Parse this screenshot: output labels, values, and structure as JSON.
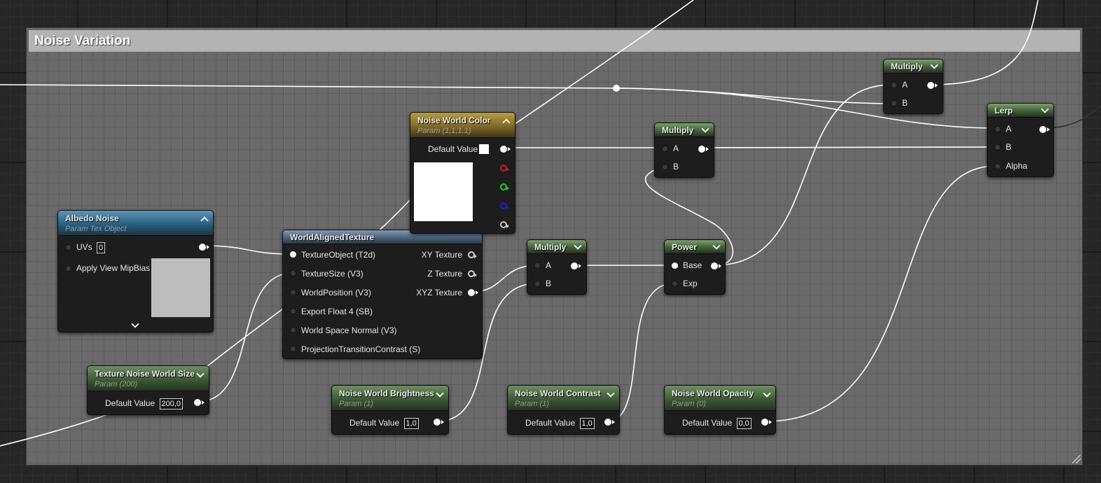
{
  "comment": {
    "title": "Noise Variation"
  },
  "nodes": {
    "albedo_noise": {
      "title": "Albedo Noise",
      "subtitle": "Param Tex Object",
      "uvs_label": "UVs",
      "uvs_value": "0",
      "mipbias_label": "Apply View MipBias"
    },
    "world_aligned_texture": {
      "title": "WorldAlignedTexture",
      "inputs": [
        "TextureObject (T2d)",
        "TextureSize (V3)",
        "WorldPosition (V3)",
        "Export Float 4 (SB)",
        "World Space Normal (V3)",
        "ProjectionTransitionContrast (S)"
      ],
      "outputs": [
        "XY Texture",
        "Z Texture",
        "XYZ Texture"
      ]
    },
    "noise_world_color": {
      "title": "Noise World Color",
      "subtitle": "Param (1,1,1,1)",
      "default_label": "Default Value"
    },
    "texture_noise_world_size": {
      "title": "Texture Noise World Size",
      "subtitle": "Param (200)",
      "default_label": "Default Value",
      "default_value": "200,0"
    },
    "noise_world_brightness": {
      "title": "Noise World Brightness",
      "subtitle": "Param (1)",
      "default_label": "Default Value",
      "default_value": "1,0"
    },
    "noise_world_contrast": {
      "title": "Noise World Contrast",
      "subtitle": "Param (1)",
      "default_label": "Default Value",
      "default_value": "1,0"
    },
    "noise_world_opacity": {
      "title": "Noise World Opacity",
      "subtitle": "Param (0)",
      "default_label": "Default Value",
      "default_value": "0,0"
    },
    "multiply_1": {
      "title": "Multiply",
      "a": "A",
      "b": "B"
    },
    "multiply_2": {
      "title": "Multiply",
      "a": "A",
      "b": "B"
    },
    "multiply_3": {
      "title": "Multiply",
      "a": "A",
      "b": "B"
    },
    "power": {
      "title": "Power",
      "base": "Base",
      "exp": "Exp"
    },
    "lerp": {
      "title": "Lerp",
      "a": "A",
      "b": "B",
      "alpha": "Alpha"
    }
  },
  "colors": {
    "canvas_bg": "#262626",
    "comment_bg": "#6a6a6a",
    "comment_title_bg": "#b3b3b3",
    "node_body": "#1c1d1c",
    "wire": "#ffffff",
    "param_header": "#4a6b40",
    "texture_param_header": "#28607f",
    "function_header": "#4b6479",
    "vector_param_header": "#7e6a28"
  },
  "icons": [
    "chevron-down-icon",
    "chevron-up-icon",
    "resize-grip-icon",
    "reroute-knot-icon"
  ]
}
